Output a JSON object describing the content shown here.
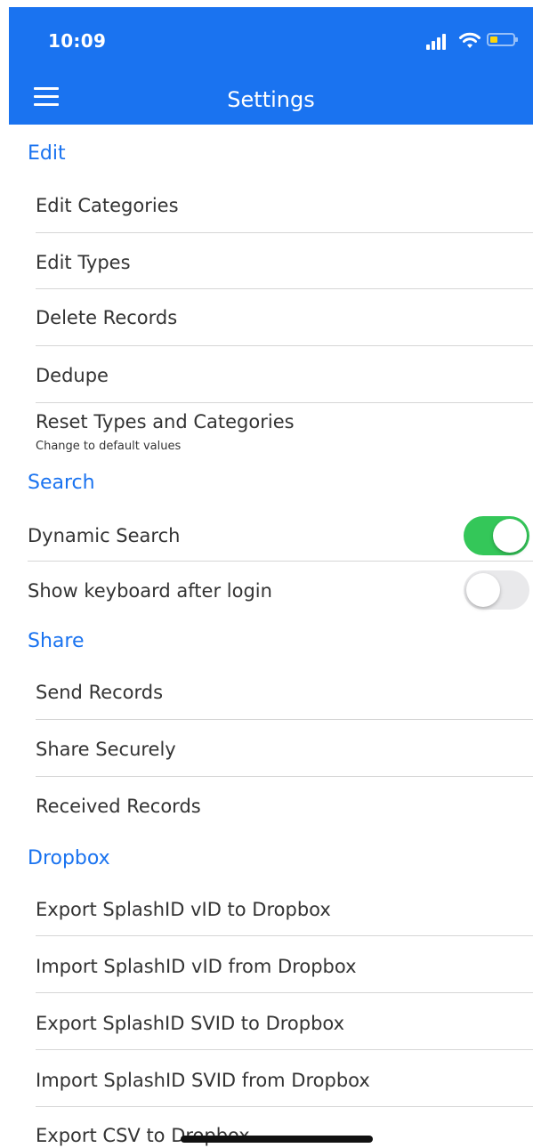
{
  "status_bar": {
    "time": "10:09"
  },
  "nav": {
    "title": "Settings"
  },
  "sections": {
    "edit": {
      "header": "Edit",
      "items": [
        {
          "label": "Edit Categories"
        },
        {
          "label": "Edit Types"
        },
        {
          "label": "Delete Records"
        },
        {
          "label": "Dedupe"
        },
        {
          "label": "Reset Types and Categories",
          "subtitle": "Change to default values"
        }
      ]
    },
    "search": {
      "header": "Search",
      "items": [
        {
          "label": "Dynamic Search",
          "toggle": true
        },
        {
          "label": "Show keyboard after login",
          "toggle": false
        }
      ]
    },
    "share": {
      "header": "Share",
      "items": [
        {
          "label": "Send Records"
        },
        {
          "label": "Share Securely"
        },
        {
          "label": "Received Records"
        }
      ]
    },
    "dropbox": {
      "header": "Dropbox",
      "items": [
        {
          "label": "Export SplashID vID to Dropbox"
        },
        {
          "label": "Import SplashID vID from Dropbox"
        },
        {
          "label": "Export SplashID SVID to Dropbox"
        },
        {
          "label": "Import SplashID SVID from Dropbox"
        },
        {
          "label": "Export CSV to Dropbox"
        }
      ]
    }
  },
  "colors": {
    "accent": "#1a73f0",
    "toggle_on": "#34c759",
    "toggle_off": "#e9e9eb",
    "battery": "#ffd60a"
  },
  "icons": {
    "menu": "hamburger-menu-icon",
    "signal": "cellular-signal-icon",
    "wifi": "wifi-icon",
    "battery": "battery-icon"
  }
}
